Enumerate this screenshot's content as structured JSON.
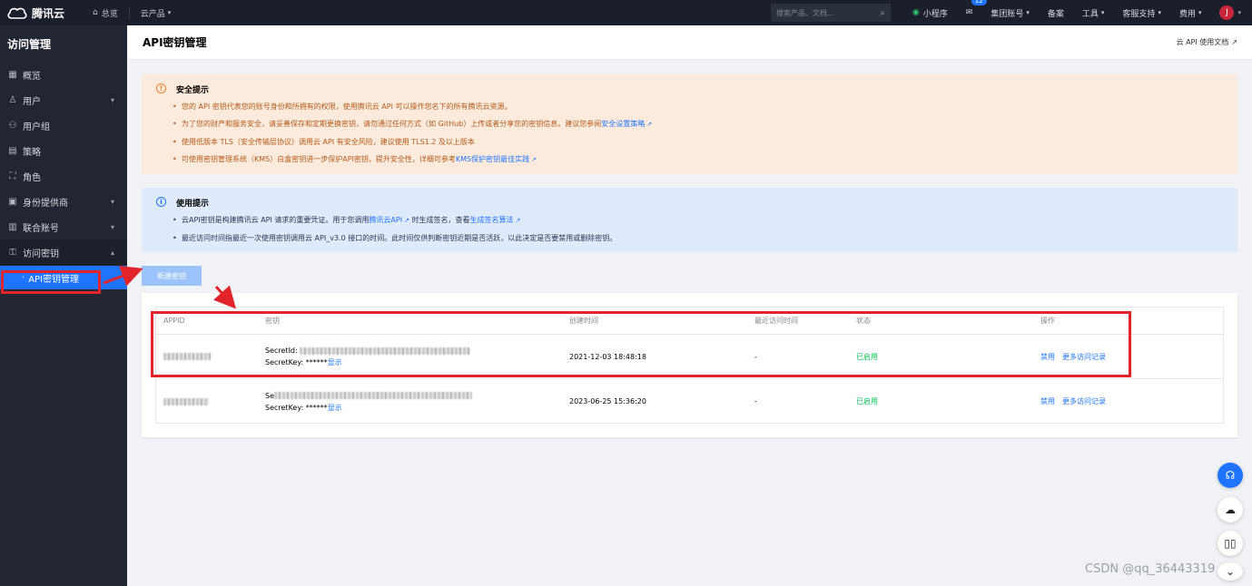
{
  "topbar": {
    "brand": "腾讯云",
    "overview": "总览",
    "products": "云产品",
    "search_placeholder": "搜索产品、文档...",
    "mini_program": "小程序",
    "mail_count": "12",
    "group_account": "集团账号",
    "filing": "备案",
    "tools": "工具",
    "support": "客服支持",
    "billing": "费用",
    "avatar_letter": "J"
  },
  "sidebar": {
    "title": "访问管理",
    "items": [
      {
        "label": "概览",
        "icon": "grid-icon"
      },
      {
        "label": "用户",
        "icon": "user-icon"
      },
      {
        "label": "用户组",
        "icon": "users-icon"
      },
      {
        "label": "策略",
        "icon": "policy-icon"
      },
      {
        "label": "角色",
        "icon": "role-icon"
      },
      {
        "label": "身份提供商",
        "icon": "idp-icon"
      },
      {
        "label": "联合账号",
        "icon": "federation-icon"
      },
      {
        "label": "访问密钥",
        "icon": "key-icon"
      }
    ],
    "sub_active": "API密钥管理"
  },
  "header": {
    "title": "API密钥管理",
    "doc_link": "云 API 使用文档"
  },
  "security_alert": {
    "title": "安全提示",
    "items": [
      "您的 API 密钥代表您的账号身份和所拥有的权限，使用腾讯云 API 可以操作您名下的所有腾讯云资源。",
      "为了您的财产和服务安全，请妥善保存和定期更换密钥，请勿通过任何方式（如 GitHub）上传或者分享您的密钥信息。建议您参阅",
      "使用低版本 TLS（安全传输层协议）调用云 API 有安全风险，建议使用 TLS1.2 及以上版本",
      "可使用密钥管理系统（KMS）白盒密钥进一步保护API密钥，提升安全性，详细可参考"
    ],
    "link_security_policy": "安全设置策略",
    "link_kms": "KMS保护密钥最佳实践"
  },
  "usage_alert": {
    "title": "使用提示",
    "item1_pre": "云API密钥是构建腾讯云 API 请求的重要凭证。用于您调用",
    "item1_link1": "腾讯云API",
    "item1_mid": "时生成签名，查看",
    "item1_link2": "生成签名算法",
    "item2": "最近访问时间指最近一次使用密钥调用云 API_v3.0 接口的时间。此时间仅供判断密钥近期是否活跃，以此决定是否要禁用或删除密钥。"
  },
  "new_key_button": "新建密钥",
  "table": {
    "headers": [
      "APPID",
      "密钥",
      "创建时间",
      "最近访问时间",
      "状态",
      "操作"
    ],
    "rows": [
      {
        "secret_id_label": "SecretId:",
        "secret_key_label": "SecretKey: ******",
        "show": "显示",
        "created": "2021-12-03 18:48:18",
        "last_access": "-",
        "status": "已启用",
        "action_disable": "禁用",
        "action_more": "更多访问记录"
      },
      {
        "secret_id_label": "Se",
        "secret_key_label": "SecretKey: ******",
        "show": "显示",
        "created": "2023-06-25 15:36:20",
        "last_access": "-",
        "status": "已启用",
        "action_disable": "禁用",
        "action_more": "更多访问记录"
      }
    ]
  },
  "watermark": "CSDN @qq_36443319",
  "colors": {
    "accent": "#1f74ff",
    "highlight": "#e2232a",
    "warn_bg": "#fcebdc",
    "info_bg": "#dfeafc",
    "status_ok": "#0abf5b"
  }
}
